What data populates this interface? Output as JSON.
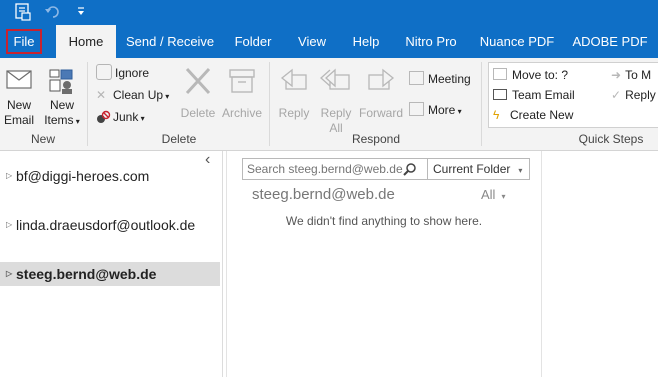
{
  "tabs": [
    "File",
    "Home",
    "Send / Receive",
    "Folder",
    "View",
    "Help",
    "Nitro Pro",
    "Nuance PDF",
    "ADOBE PDF"
  ],
  "ribbon": {
    "new_group": {
      "new_email": [
        "New",
        "Email"
      ],
      "new_items": [
        "New",
        "Items"
      ],
      "label": "New"
    },
    "delete_group": {
      "ignore": "Ignore",
      "clean_up": "Clean Up",
      "junk": "Junk",
      "delete": "Delete",
      "archive": "Archive",
      "label": "Delete"
    },
    "respond_group": {
      "reply": "Reply",
      "reply_all": [
        "Reply",
        "All"
      ],
      "forward": "Forward",
      "meeting": "Meeting",
      "more": "More",
      "label": "Respond"
    },
    "quick_steps": {
      "move_to": "Move to: ?",
      "team_email": "Team Email",
      "create_new": "Create New",
      "to_manager": "To M",
      "reply_delete": "Reply",
      "label": "Quick Steps"
    }
  },
  "nav": {
    "collapse_glyph": "‹",
    "accounts": [
      {
        "name": "bf@diggi-heroes.com",
        "bold": false
      },
      {
        "name": "linda.draeusdorf@outlook.de",
        "bold": false
      },
      {
        "name": "steeg.bernd@web.de",
        "bold": true
      }
    ]
  },
  "list": {
    "search_placeholder": "Search steeg.bernd@web.de",
    "scope": "Current Folder",
    "folder_title": "steeg.bernd@web.de",
    "filter": "All",
    "empty_message": "We didn't find anything to show here."
  }
}
